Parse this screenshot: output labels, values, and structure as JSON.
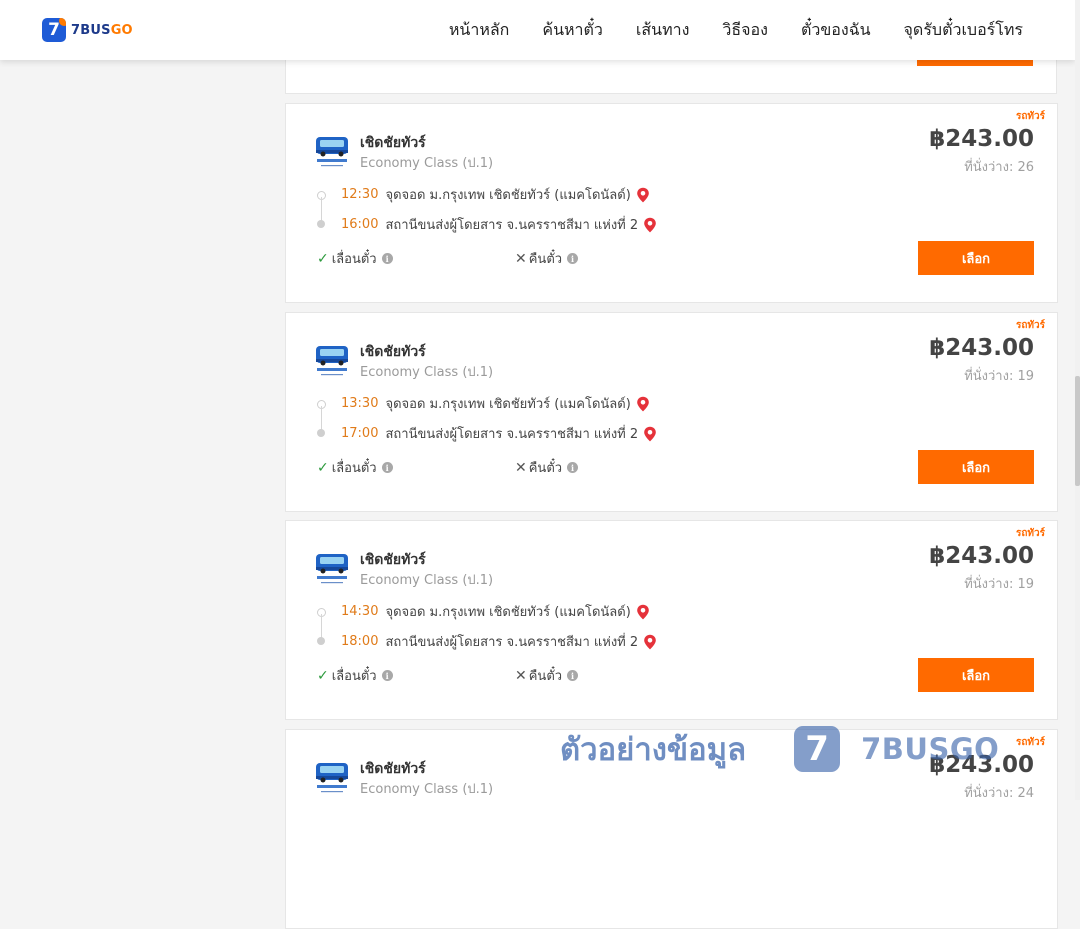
{
  "header": {
    "logo_digit": "7",
    "logo_text_main": "7BUS",
    "logo_text_accent": "GO",
    "nav": [
      {
        "label": "หน้าหลัก"
      },
      {
        "label": "ค้นหาตั๋ว"
      },
      {
        "label": "เส้นทาง"
      },
      {
        "label": "วิธีจอง"
      },
      {
        "label": "ตั๋วของฉัน"
      },
      {
        "label": "จุดรับตั๋วเบอร์โทร"
      }
    ]
  },
  "colors": {
    "accent": "#ff6a00",
    "brand_blue": "#1e5bd6",
    "time": "#e07b1a",
    "check": "#2c9a3c"
  },
  "trips": [
    {
      "tag": "รถทัวร์",
      "operator": "เชิดชัยทัวร์",
      "class": "Economy Class (ป.1)",
      "price": "฿243.00",
      "seats": "ที่นั่งว่าง: 26",
      "dep_time": "12:30",
      "dep_place": "จุดจอด ม.กรุงเทพ เชิดชัยทัวร์ (แมคโดนัลด์)",
      "arr_time": "16:00",
      "arr_place": "สถานีขนส่งผู้โดยสาร จ.นครราชสีมา แห่งที่ 2",
      "policy_change": "เลื่อนตั๋ว",
      "policy_refund": "คืนตั๋ว",
      "select_label": "เลือก"
    },
    {
      "tag": "รถทัวร์",
      "operator": "เชิดชัยทัวร์",
      "class": "Economy Class (ป.1)",
      "price": "฿243.00",
      "seats": "ที่นั่งว่าง: 19",
      "dep_time": "13:30",
      "dep_place": "จุดจอด ม.กรุงเทพ เชิดชัยทัวร์ (แมคโดนัลด์)",
      "arr_time": "17:00",
      "arr_place": "สถานีขนส่งผู้โดยสาร จ.นครราชสีมา แห่งที่ 2",
      "policy_change": "เลื่อนตั๋ว",
      "policy_refund": "คืนตั๋ว",
      "select_label": "เลือก"
    },
    {
      "tag": "รถทัวร์",
      "operator": "เชิดชัยทัวร์",
      "class": "Economy Class (ป.1)",
      "price": "฿243.00",
      "seats": "ที่นั่งว่าง: 19",
      "dep_time": "14:30",
      "dep_place": "จุดจอด ม.กรุงเทพ เชิดชัยทัวร์ (แมคโดนัลด์)",
      "arr_time": "18:00",
      "arr_place": "สถานีขนส่งผู้โดยสาร จ.นครราชสีมา แห่งที่ 2",
      "policy_change": "เลื่อนตั๋ว",
      "policy_refund": "คืนตั๋ว",
      "select_label": "เลือก"
    },
    {
      "tag": "รถทัวร์",
      "operator": "เชิดชัยทัวร์",
      "class": "Economy Class (ป.1)",
      "price": "฿243.00",
      "seats": "ที่นั่งว่าง: 24"
    }
  ],
  "watermark": {
    "text": "ตัวอย่างข้อมูล",
    "badge": "7",
    "brand": "7BUSGO"
  }
}
